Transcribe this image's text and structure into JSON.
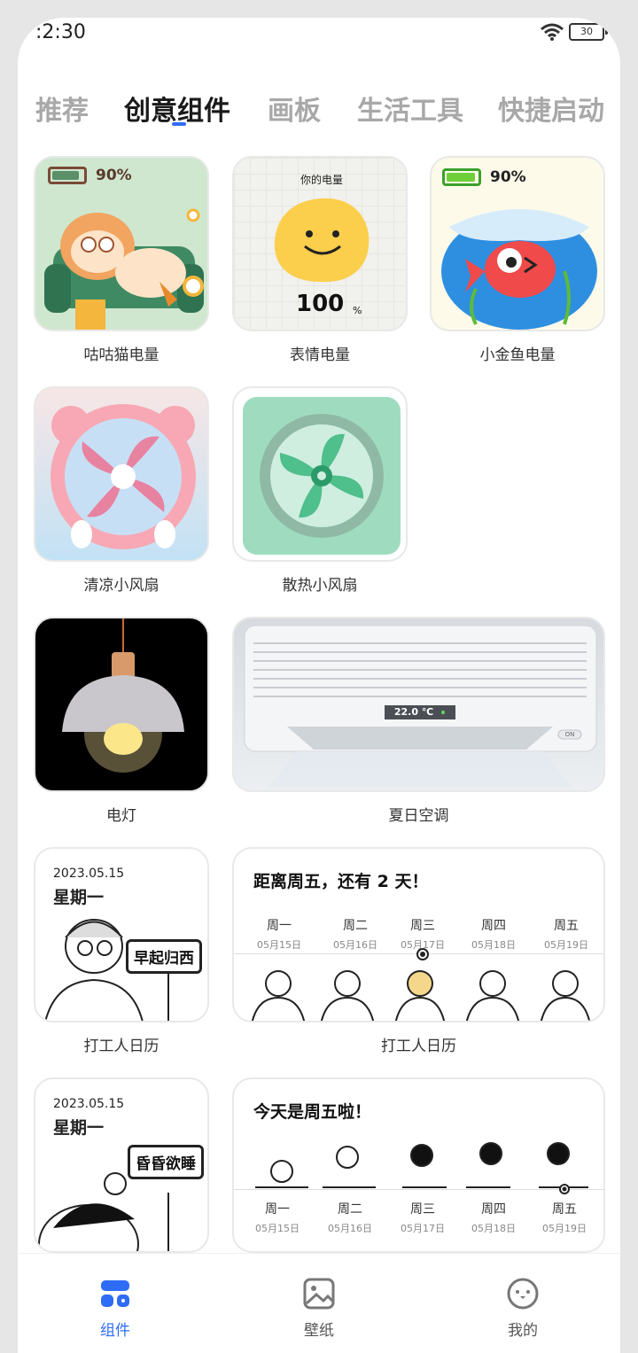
{
  "status": {
    "time": ":2:30",
    "battery": "30"
  },
  "tabs": [
    "推荐",
    "创意组件",
    "画板",
    "生活工具",
    "快捷启动"
  ],
  "widgets": {
    "gugu_cat": {
      "label": "咕咕猫电量",
      "battery_pct": "90%"
    },
    "emoji": {
      "label": "表情电量",
      "title": "你的电量",
      "value": "100",
      "unit": "%"
    },
    "goldfish": {
      "label": "小金鱼电量",
      "battery_pct": "90%"
    },
    "cool_fan": {
      "label": "清凉小风扇"
    },
    "heat_fan": {
      "label": "散热小风扇"
    },
    "lamp": {
      "label": "电灯"
    },
    "aircon": {
      "label": "夏日空调",
      "temp": "22.0 ℃",
      "switch": "ON"
    },
    "worker_cal_small": {
      "label": "打工人日历",
      "date": "2023.05.15",
      "weekday": "星期一",
      "sign": "早起归西"
    },
    "worker_cal_wide": {
      "label": "打工人日历",
      "title": "距离周五，还有 2 天！",
      "days": [
        {
          "day": "周一",
          "date": "05月15日"
        },
        {
          "day": "周二",
          "date": "05月16日"
        },
        {
          "day": "周三",
          "date": "05月17日"
        },
        {
          "day": "周四",
          "date": "05月18日"
        },
        {
          "day": "周五",
          "date": "05月19日"
        }
      ]
    },
    "sleepy_cal_small": {
      "date": "2023.05.15",
      "weekday": "星期一",
      "sign": "昏昏欲睡"
    },
    "friday_cal_wide": {
      "title": "今天是周五啦！",
      "days": [
        {
          "day": "周一",
          "date": "05月15日"
        },
        {
          "day": "周二",
          "date": "05月16日"
        },
        {
          "day": "周三",
          "date": "05月17日"
        },
        {
          "day": "周四",
          "date": "05月18日"
        },
        {
          "day": "周五",
          "date": "05月19日"
        }
      ]
    }
  },
  "bottom_nav": [
    "组件",
    "壁纸",
    "我的"
  ],
  "colors": {
    "accent": "#2f6cf6"
  }
}
